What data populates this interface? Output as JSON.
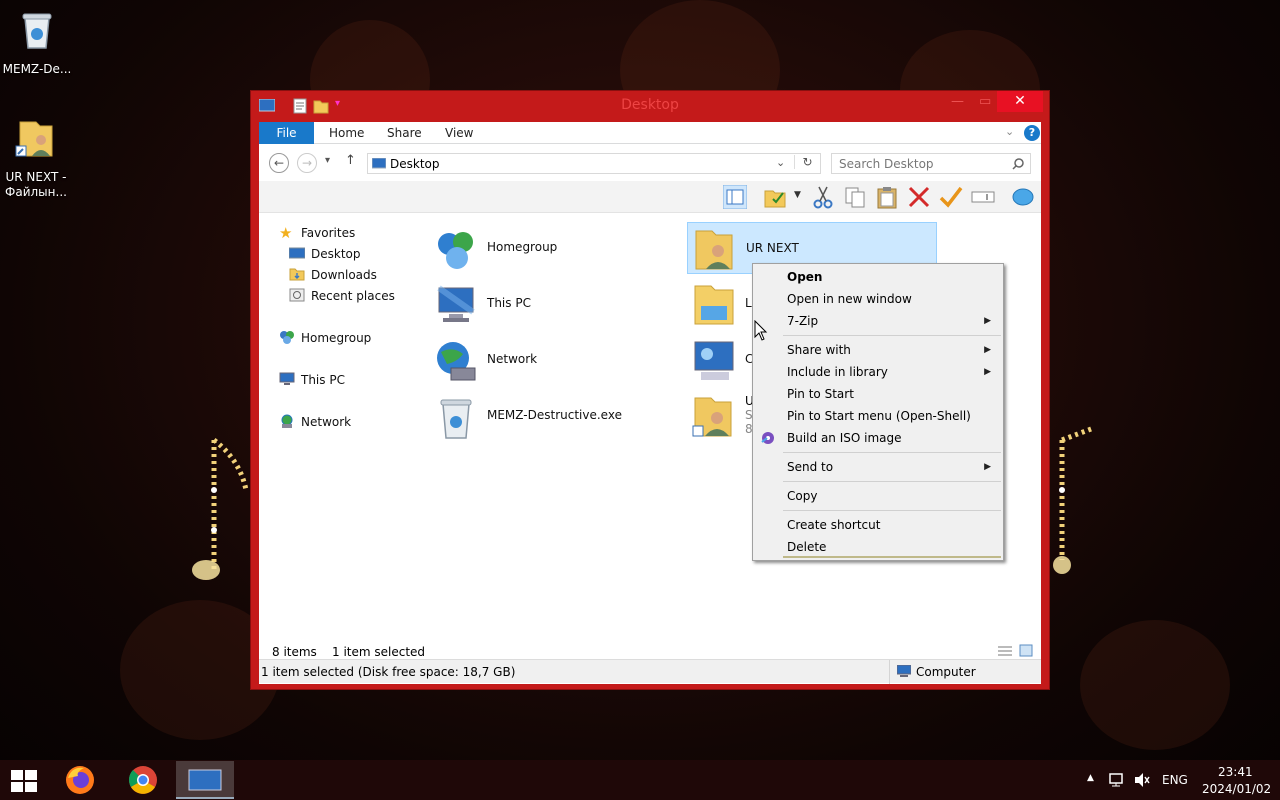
{
  "desktop": {
    "icons": [
      {
        "label": "MEMZ-De..."
      },
      {
        "label": "UR NEXT - Файлын..."
      }
    ]
  },
  "window": {
    "title": "Desktop",
    "close_glyph": "✕",
    "ribbon": {
      "file_label": "File",
      "tabs": [
        "Home",
        "Share",
        "View"
      ]
    },
    "address": {
      "path": "Desktop",
      "search_placeholder": "Search Desktop"
    },
    "nav": {
      "favorites": "Favorites",
      "desktop": "Desktop",
      "downloads": "Downloads",
      "recent": "Recent places",
      "homegroup": "Homegroup",
      "thispc": "This PC",
      "network": "Network"
    },
    "files": [
      {
        "name": "Homegroup",
        "icon": "homegroup-icon"
      },
      {
        "name": "This PC",
        "icon": "computer-icon"
      },
      {
        "name": "Network",
        "icon": "network-icon"
      },
      {
        "name": "MEMZ-Destructive.exe",
        "icon": "recycle-bin-icon"
      },
      {
        "name": "UR NEXT",
        "icon": "user-folder-icon"
      },
      {
        "name": "Li",
        "icon": "libraries-icon"
      },
      {
        "name": "C",
        "icon": "control-panel-icon"
      },
      {
        "name": "U",
        "sub1": "Sh",
        "sub2": "81",
        "icon": "user-shortcut-icon"
      }
    ],
    "status": {
      "items": "8 items",
      "selected": "1 item selected",
      "disk": "1 item selected (Disk free space: 18,7 GB)",
      "computer": "Computer"
    }
  },
  "context_menu": {
    "items": [
      {
        "label": "Open"
      },
      {
        "label": "Open in new window"
      },
      {
        "label": "7-Zip"
      },
      {
        "label": "Share with"
      },
      {
        "label": "Include in library"
      },
      {
        "label": "Pin to Start"
      },
      {
        "label": "Pin to Start menu (Open-Shell)"
      },
      {
        "label": "Build an ISO image"
      },
      {
        "label": "Send to"
      },
      {
        "label": "Copy"
      },
      {
        "label": "Create shortcut"
      },
      {
        "label": "Delete"
      }
    ],
    "submenu_glyph": "▶"
  },
  "taskbar": {
    "language": "ENG",
    "time": "23:41",
    "date": "2024/01/02",
    "tray_up_glyph": "▲"
  },
  "colors": {
    "window_frame": "#c41a1a",
    "accent": "#1979ca",
    "selection": "#cce8ff"
  }
}
